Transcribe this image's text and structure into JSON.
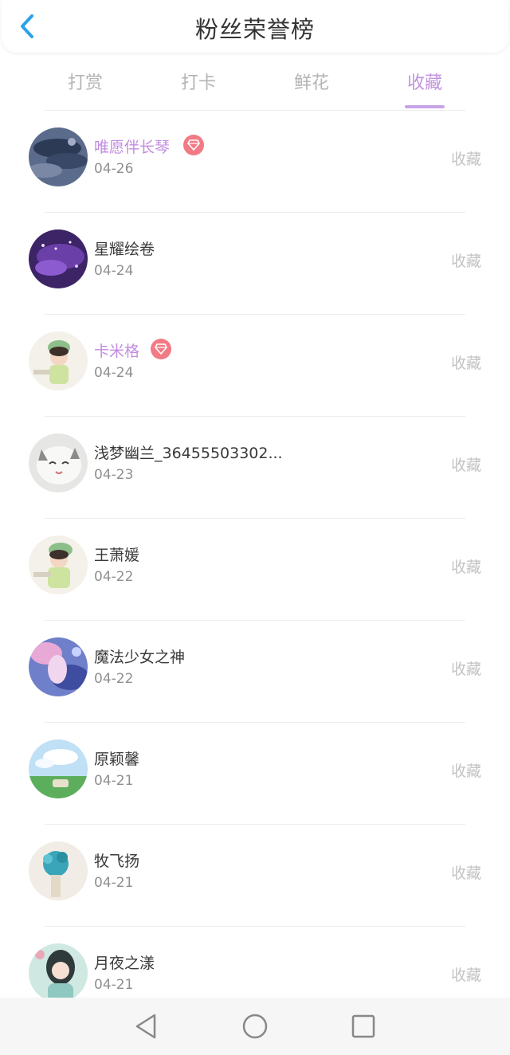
{
  "header": {
    "title": "粉丝荣誉榜",
    "back_icon": "chevron-left-icon"
  },
  "tabs": [
    {
      "label": "打赏",
      "active": false
    },
    {
      "label": "打卡",
      "active": false
    },
    {
      "label": "鲜花",
      "active": false
    },
    {
      "label": "收藏",
      "active": true
    }
  ],
  "colors": {
    "accent": "#c192e0",
    "vip_name": "#c28ce0",
    "vip_badge": "#f27a85",
    "back_icon": "#2ba3e8"
  },
  "fans": [
    {
      "name": "唯愿伴长琴",
      "date": "04-26",
      "action": "收藏",
      "vip": true
    },
    {
      "name": "星耀绘卷",
      "date": "04-24",
      "action": "收藏",
      "vip": false
    },
    {
      "name": "卡米格",
      "date": "04-24",
      "action": "收藏",
      "vip": true
    },
    {
      "name": "浅梦幽兰_36455503302...",
      "date": "04-23",
      "action": "收藏",
      "vip": false
    },
    {
      "name": "王萧媛",
      "date": "04-22",
      "action": "收藏",
      "vip": false
    },
    {
      "name": "魔法少女之神",
      "date": "04-22",
      "action": "收藏",
      "vip": false
    },
    {
      "name": "原颖馨",
      "date": "04-21",
      "action": "收藏",
      "vip": false
    },
    {
      "name": "牧飞扬",
      "date": "04-21",
      "action": "收藏",
      "vip": false
    },
    {
      "name": "月夜之漾",
      "date": "04-21",
      "action": "收藏",
      "vip": false
    }
  ],
  "navbar": {
    "icons": [
      "back-triangle-icon",
      "home-circle-icon",
      "recents-square-icon"
    ]
  }
}
